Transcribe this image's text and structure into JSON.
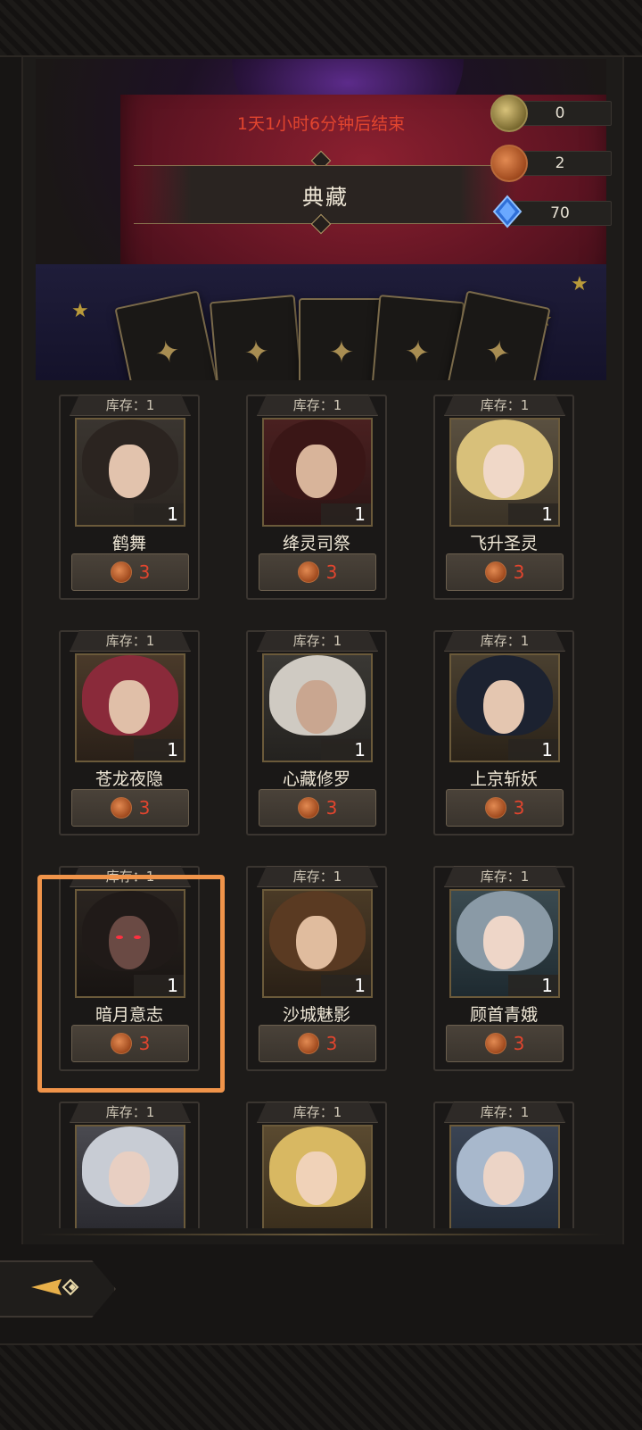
{
  "header": {
    "timer_text": "1天1小时6分钟后结束",
    "title": "典藏"
  },
  "resources": [
    {
      "icon": "gold-coin-icon",
      "value": "0"
    },
    {
      "icon": "copper-coin-icon",
      "value": "2"
    },
    {
      "icon": "blue-crystal-icon",
      "value": "70"
    }
  ],
  "colors": {
    "accent_red": "#e2452e",
    "highlight_orange": "#f0944a"
  },
  "cards": [
    {
      "stock": "库存：1",
      "name": "鹤舞",
      "count": "1",
      "price": "3"
    },
    {
      "stock": "库存：1",
      "name": "绛灵司祭",
      "count": "1",
      "price": "3"
    },
    {
      "stock": "库存：1",
      "name": "飞升圣灵",
      "count": "1",
      "price": "3"
    },
    {
      "stock": "库存：1",
      "name": "苍龙夜隐",
      "count": "1",
      "price": "3"
    },
    {
      "stock": "库存：1",
      "name": "心藏修罗",
      "count": "1",
      "price": "3"
    },
    {
      "stock": "库存：1",
      "name": "上京斩妖",
      "count": "1",
      "price": "3"
    },
    {
      "stock": "库存：1",
      "name": "暗月意志",
      "count": "1",
      "price": "3"
    },
    {
      "stock": "库存：1",
      "name": "沙城魅影",
      "count": "1",
      "price": "3"
    },
    {
      "stock": "库存：1",
      "name": "顾首青娥",
      "count": "1",
      "price": "3"
    },
    {
      "stock": "库存：1"
    },
    {
      "stock": "库存：1"
    },
    {
      "stock": "库存：1"
    }
  ],
  "back_button": {
    "icon": "back-arrow-icon"
  }
}
